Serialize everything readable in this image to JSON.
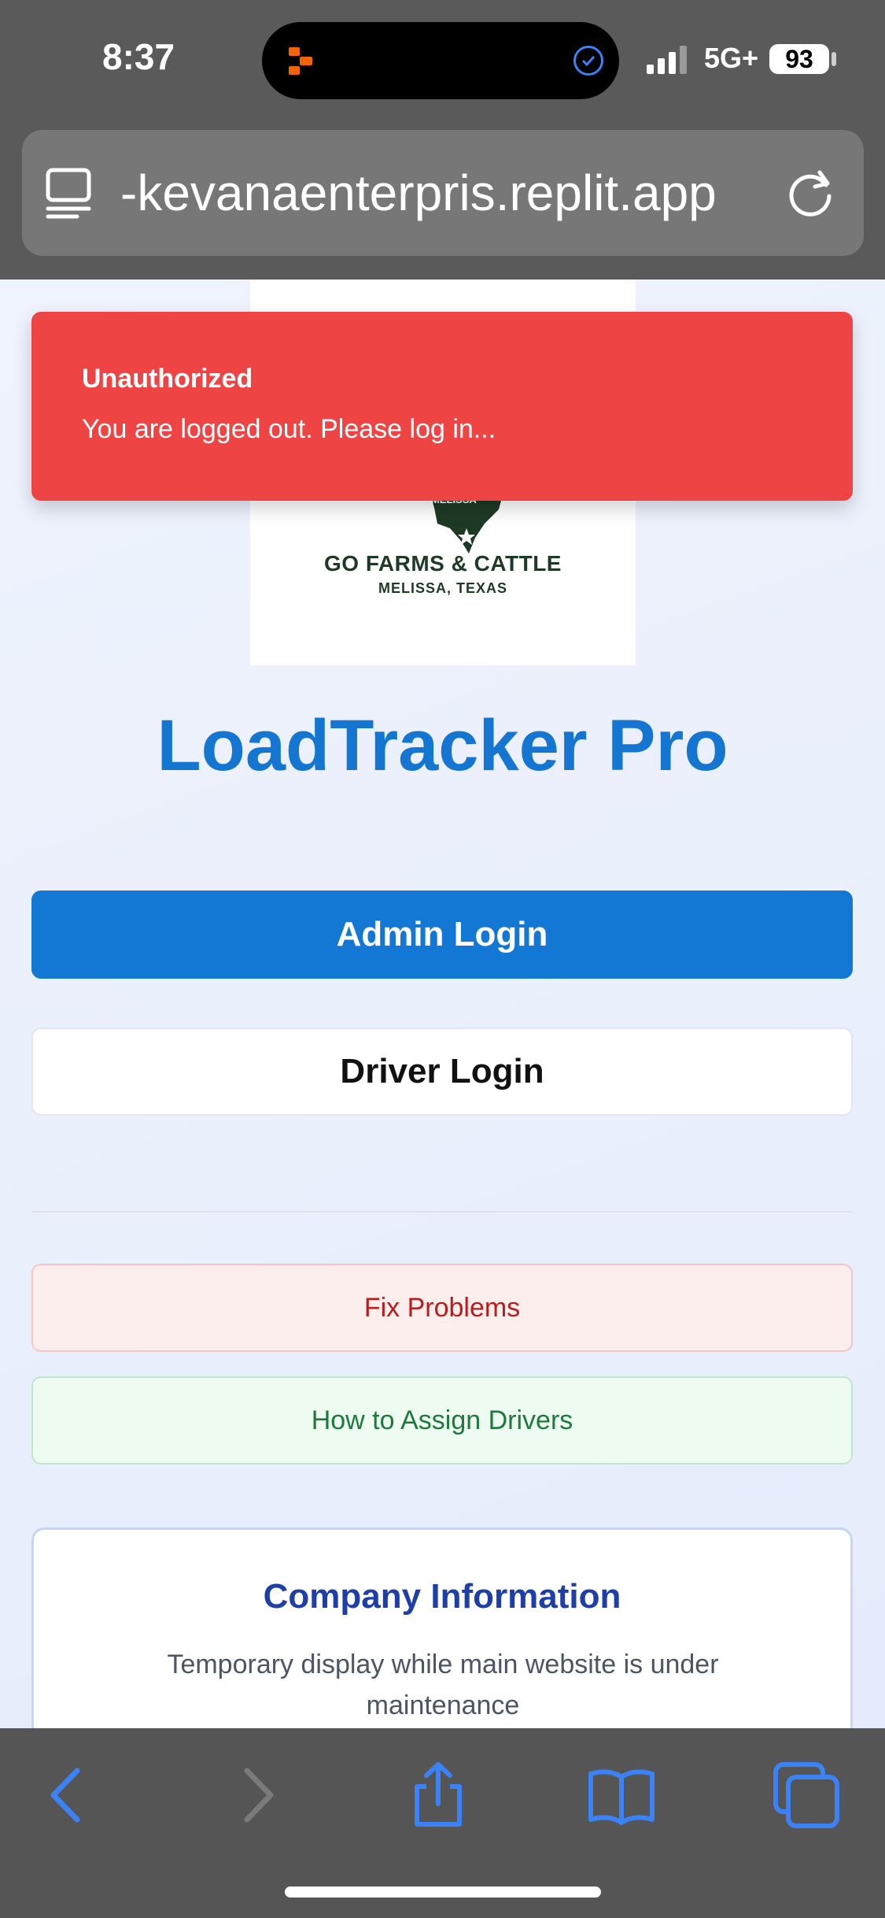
{
  "status": {
    "time": "8:37",
    "network": "5G+",
    "battery": "93"
  },
  "browser": {
    "url": "-kevanaenterpris.replit.app"
  },
  "logo": {
    "map_text": "MELISSA",
    "name": "GO FARMS & CATTLE",
    "location": "MELISSA, TEXAS"
  },
  "toast": {
    "title": "Unauthorized",
    "message": "You are logged out. Please log in..."
  },
  "page": {
    "title": "LoadTracker Pro",
    "admin_login": "Admin Login",
    "driver_login": "Driver Login",
    "fix_problems": "Fix Problems",
    "assign_drivers": "How to Assign Drivers",
    "company_info_title": "Company Information",
    "company_info_text": "Temporary display while main website is under maintenance"
  },
  "icons": {
    "back": "chevron-left-icon",
    "forward": "chevron-right-icon",
    "share": "share-icon",
    "bookmarks": "book-icon",
    "tabs": "tabs-icon"
  },
  "colors": {
    "primary": "#1278d4",
    "toast": "#ef4444",
    "title": "#1576d1"
  }
}
